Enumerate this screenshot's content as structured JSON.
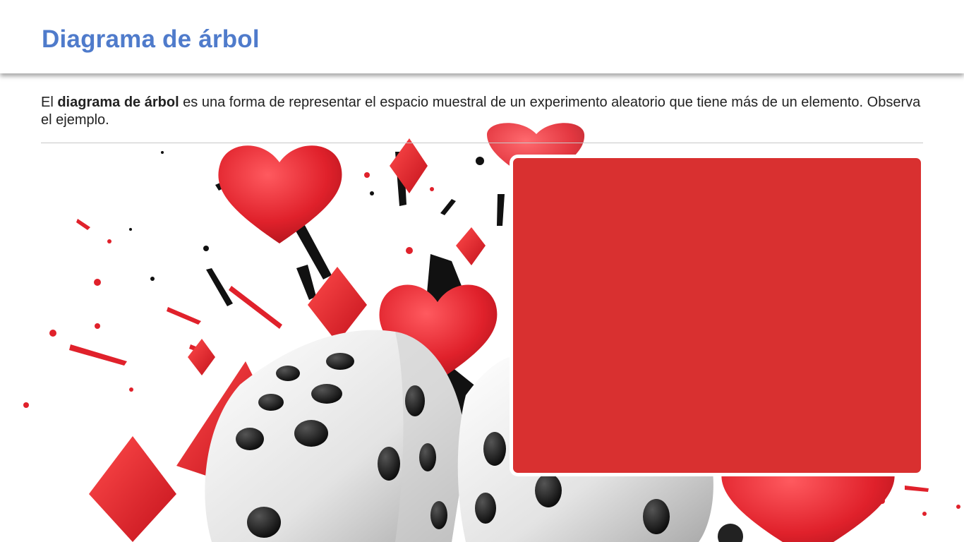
{
  "header": {
    "title": "Diagrama de árbol"
  },
  "intro": {
    "lead": "El ",
    "bold": "diagrama de árbol",
    "rest": " es una forma de representar el espacio muestral de un experimento aleatorio que tiene más de un elemento. Observa el ejemplo."
  },
  "colors": {
    "title": "#4f7bcb",
    "panel": "#d93030",
    "red": "#e0212b",
    "black": "#111111"
  },
  "icons": [
    "heart-icon",
    "diamond-icon",
    "dice-icon",
    "ink-splash-icon"
  ]
}
